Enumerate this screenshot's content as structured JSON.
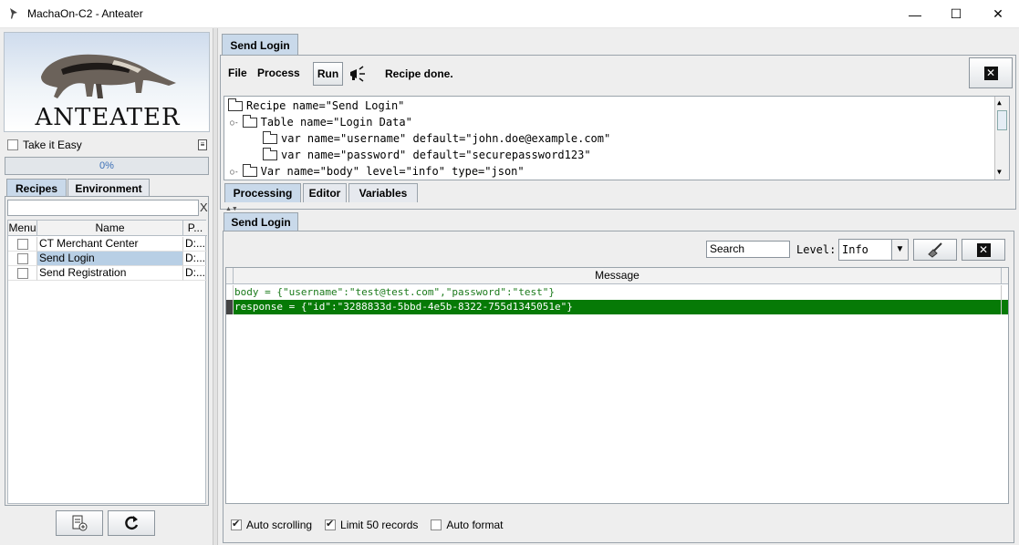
{
  "window": {
    "title": "MachaOn-C2 - Anteater",
    "min_glyph": "—",
    "max_glyph": "☐",
    "close_glyph": "✕"
  },
  "left": {
    "logo_text": "ANTEATER",
    "take_it_easy": "Take it Easy",
    "progress": "0%",
    "progress_value": 0,
    "tabs": [
      "Recipes",
      "Environment"
    ],
    "filter_clear": "X",
    "table": {
      "headers": [
        "Menu",
        "Name",
        "P..."
      ],
      "rows": [
        {
          "name": "CT Merchant Center",
          "p": "D:..."
        },
        {
          "name": "Send Login",
          "p": "D:...",
          "selected": true
        },
        {
          "name": "Send Registration",
          "p": "D:..."
        }
      ]
    }
  },
  "right": {
    "tab_title": "Send Login",
    "toolbar": {
      "file": "File",
      "process": "Process",
      "run": "Run",
      "status": "Recipe done."
    },
    "tree": [
      "Recipe name=\"Send Login\"",
      "Table name=\"Login Data\"",
      "var name=\"username\" default=\"john.doe@example.com\"",
      "var name=\"password\" default=\"securepassword123\"",
      "Var name=\"body\" level=\"info\" type=\"json\""
    ],
    "sub_tabs": [
      "Processing",
      "Editor",
      "Variables"
    ],
    "log_panel": {
      "tab_title": "Send Login",
      "search": "Search",
      "level_label": "Level:",
      "level_value": "Info",
      "header": "Message",
      "rows": [
        "body = {\"username\":\"test@test.com\",\"password\":\"test\"}",
        "response = {\"id\":\"3288833d-5bbd-4e5b-8322-755d1345051e\"}"
      ],
      "options": [
        {
          "label": "Auto scrolling",
          "checked": true
        },
        {
          "label": "Limit 50 records",
          "checked": true
        },
        {
          "label": "Auto format",
          "checked": false
        }
      ]
    }
  },
  "colors": {
    "selected_row": "#b8cfe5",
    "log_highlight": "#067a06",
    "log_text": "#1a7a1a"
  }
}
